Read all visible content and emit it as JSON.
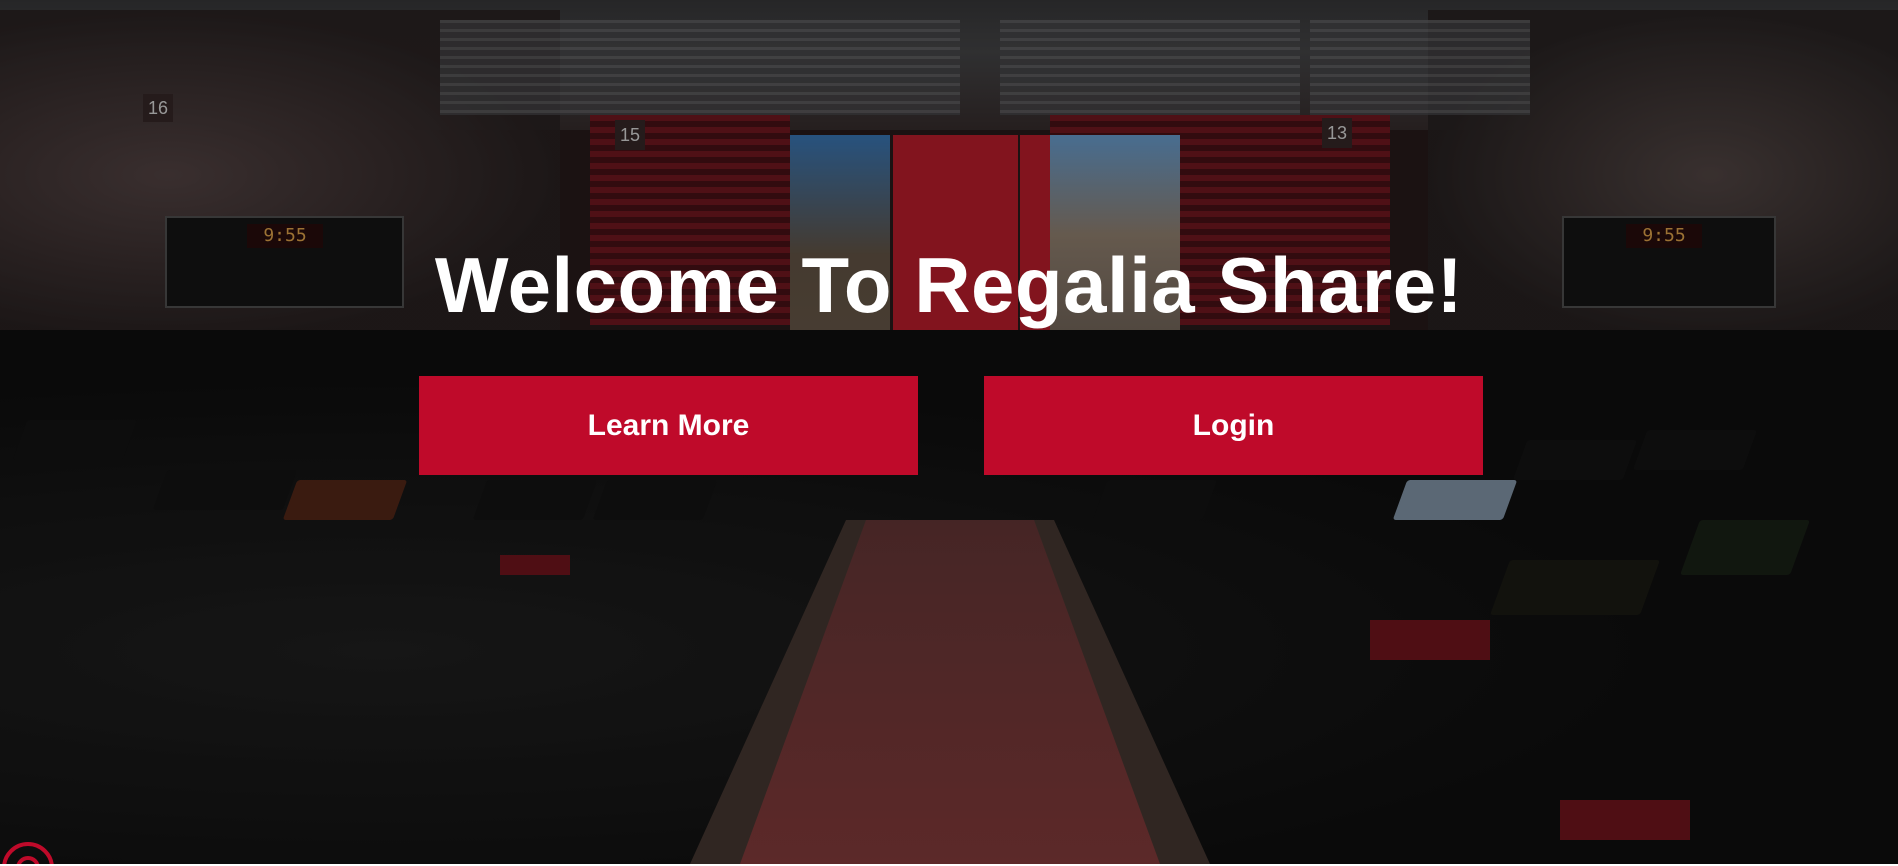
{
  "hero": {
    "title": "Welcome To Regalia Share!",
    "background_description_icon": "commencement-photo"
  },
  "buttons": {
    "learn_more_label": "Learn More",
    "login_label": "Login"
  },
  "scoreboards": {
    "left_time": "9:55",
    "right_time": "9:55"
  },
  "section_numbers": [
    "16",
    "15",
    "13"
  ],
  "colors": {
    "accent": "#bf0a2a",
    "title_text": "#ffffff",
    "button_text": "#ffffff"
  },
  "icons": {
    "corner_logo": "regalia-logo-icon"
  }
}
